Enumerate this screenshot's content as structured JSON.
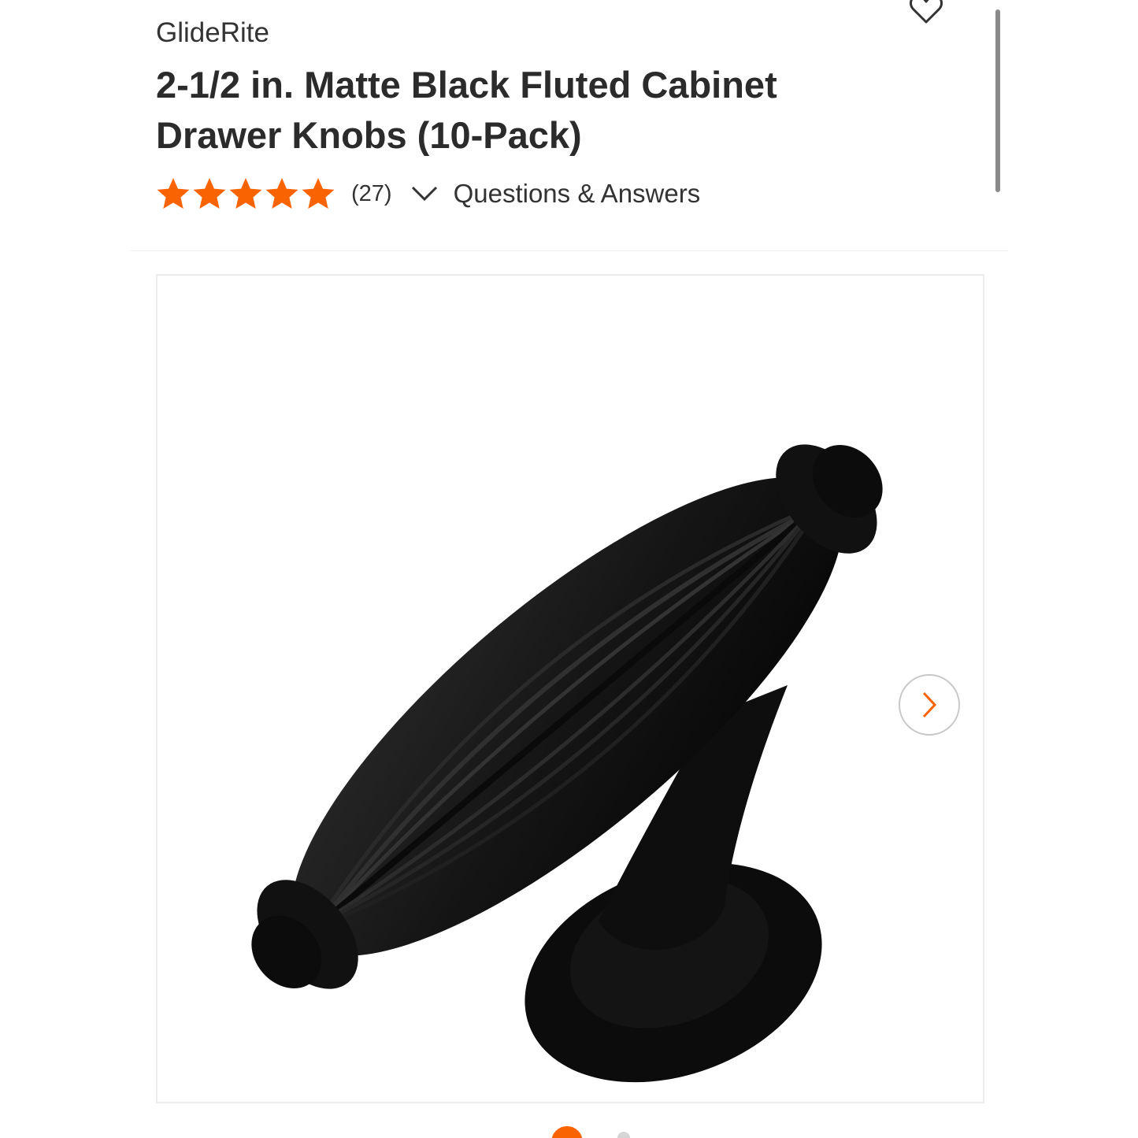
{
  "header": {
    "brand": "GlideRite",
    "title_line1": "2-1/2 in. Matte Black Fluted Cabinet",
    "title_line2": "Drawer Knobs (10-Pack)"
  },
  "rating": {
    "stars": 5,
    "review_count": "(27)",
    "qa_link": "Questions & Answers"
  },
  "gallery": {
    "image_subject": "matte black fluted T-knob",
    "current_slide": 1
  },
  "icons": {
    "favorite": "heart-icon",
    "expand": "chevron-down-icon",
    "next": "chevron-right-icon",
    "star": "star-icon"
  },
  "colors": {
    "accent": "#f96302",
    "text": "#333333",
    "knob": "#141414"
  }
}
